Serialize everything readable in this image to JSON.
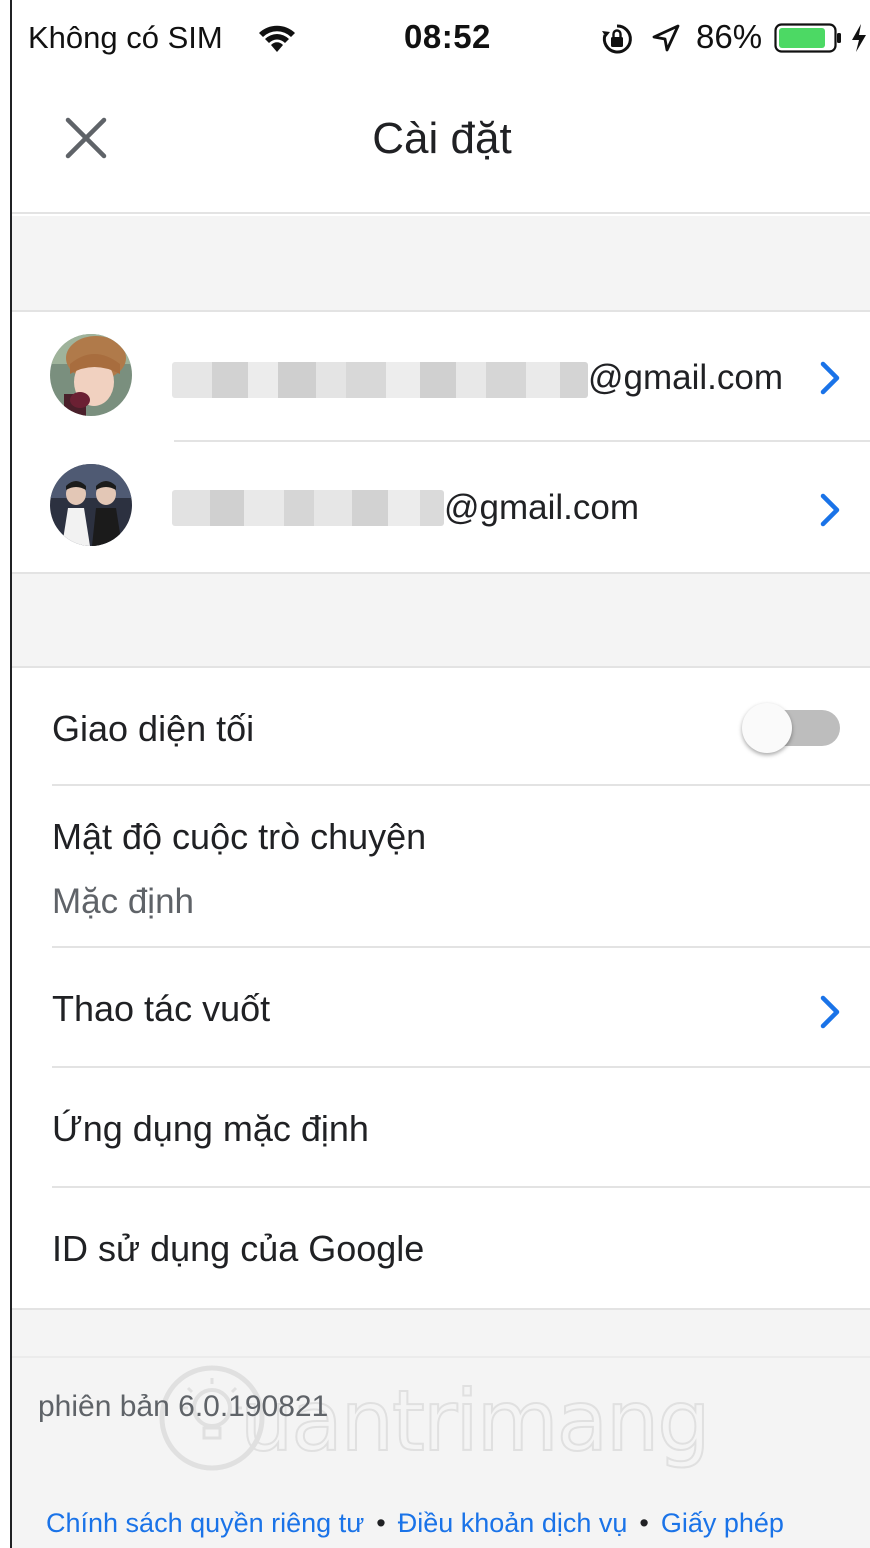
{
  "status_bar": {
    "carrier": "Không có SIM",
    "time": "08:52",
    "battery_percent": "86%",
    "battery_level": 0.86,
    "icons": [
      "wifi-icon",
      "rotation-lock-icon",
      "location-icon",
      "battery-icon",
      "charging-icon"
    ]
  },
  "header": {
    "title": "Cài đặt",
    "close_icon": "close-icon"
  },
  "accounts": [
    {
      "email_suffix": "@gmail.com",
      "avatar": "avatar-photo-1"
    },
    {
      "email_suffix": "@gmail.com",
      "avatar": "avatar-photo-2"
    }
  ],
  "settings": {
    "dark_theme": {
      "label": "Giao diện tối",
      "enabled": false
    },
    "density": {
      "label": "Mật độ cuộc trò chuyện",
      "value": "Mặc định"
    },
    "swipe": {
      "label": "Thao tác vuốt"
    },
    "default_apps": {
      "label": "Ứng dụng mặc định"
    },
    "google_usage_id": {
      "label": "ID sử dụng của Google"
    }
  },
  "footer": {
    "version_label": "phiên bản",
    "version_number": "6.0.190821",
    "links": {
      "privacy": "Chính sách quyền riêng tư",
      "terms": "Điều khoản dịch vụ",
      "licenses": "Giấy phép"
    },
    "separator": "•",
    "watermark": "uantrimang"
  },
  "colors": {
    "accent": "#1a73e8",
    "section_bg": "#f4f4f4",
    "divider": "#e3e3e3",
    "battery_green": "#4cd964"
  }
}
